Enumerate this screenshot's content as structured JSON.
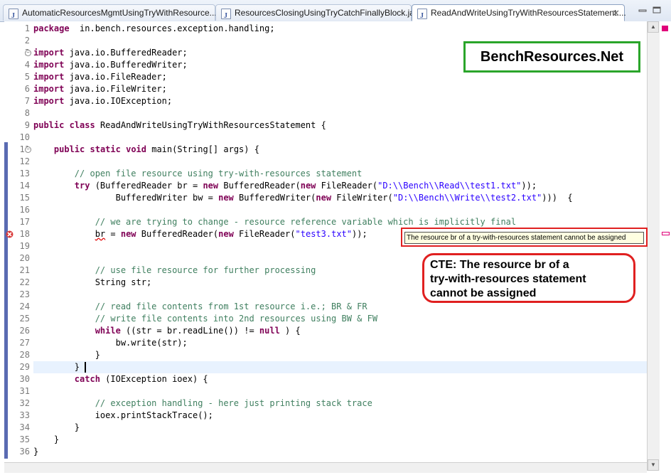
{
  "tabs": [
    {
      "label": "AutomaticResourcesMgmtUsingTryWithResource..."
    },
    {
      "label": "ResourcesClosingUsingTryCatchFinallyBlock.java"
    },
    {
      "label": "ReadAndWriteUsingTryWithResourcesStatement....",
      "close": "✕"
    }
  ],
  "brand": "BenchResources.Net",
  "tooltip": "The resource br of a try-with-resources statement cannot be assigned",
  "callout": [
    "CTE: The resource br of a",
    "try-with-resources statement",
    "cannot be assigned"
  ],
  "colors": {
    "keyword": "#7f0055",
    "comment": "#3f7f5f",
    "string": "#2a00ff",
    "error": "#e02020",
    "brand_border": "#2aa52a"
  },
  "code": [
    {
      "n": "1",
      "tokens": [
        [
          "kw",
          "package"
        ],
        [
          "",
          "  in.bench.resources.exception.handling;"
        ]
      ]
    },
    {
      "n": "2",
      "tokens": []
    },
    {
      "n": "3",
      "fold": "−",
      "tokens": [
        [
          "kw",
          "import"
        ],
        [
          "",
          " java.io.BufferedReader;"
        ]
      ]
    },
    {
      "n": "4",
      "tokens": [
        [
          "kw",
          "import"
        ],
        [
          "",
          " java.io.BufferedWriter;"
        ]
      ]
    },
    {
      "n": "5",
      "tokens": [
        [
          "kw",
          "import"
        ],
        [
          "",
          " java.io.FileReader;"
        ]
      ]
    },
    {
      "n": "6",
      "tokens": [
        [
          "kw",
          "import"
        ],
        [
          "",
          " java.io.FileWriter;"
        ]
      ]
    },
    {
      "n": "7",
      "tokens": [
        [
          "kw",
          "import"
        ],
        [
          "",
          " java.io.IOException;"
        ]
      ]
    },
    {
      "n": "8",
      "tokens": []
    },
    {
      "n": "9",
      "tokens": [
        [
          "kw",
          "public"
        ],
        [
          "",
          " "
        ],
        [
          "kw",
          "class"
        ],
        [
          "",
          " ReadAndWriteUsingTryWithResourcesStatement {"
        ]
      ]
    },
    {
      "n": "10",
      "tokens": []
    },
    {
      "n": "11",
      "fold": "−",
      "tokens": [
        [
          "",
          "    "
        ],
        [
          "kw",
          "public"
        ],
        [
          "",
          " "
        ],
        [
          "kw",
          "static"
        ],
        [
          "",
          " "
        ],
        [
          "kw",
          "void"
        ],
        [
          "",
          " main(String[] args) {"
        ]
      ]
    },
    {
      "n": "12",
      "tokens": []
    },
    {
      "n": "13",
      "tokens": [
        [
          "",
          "        "
        ],
        [
          "cm",
          "// open file resource using try-with-resources statement"
        ]
      ]
    },
    {
      "n": "14",
      "tokens": [
        [
          "",
          "        "
        ],
        [
          "kw",
          "try"
        ],
        [
          "",
          " (BufferedReader br = "
        ],
        [
          "kw",
          "new"
        ],
        [
          "",
          " BufferedReader("
        ],
        [
          "kw",
          "new"
        ],
        [
          "",
          " FileReader("
        ],
        [
          "st",
          "\"D:\\\\Bench\\\\Read\\\\test1.txt\""
        ],
        [
          "",
          "));"
        ]
      ]
    },
    {
      "n": "15",
      "tokens": [
        [
          "",
          "                BufferedWriter bw = "
        ],
        [
          "kw",
          "new"
        ],
        [
          "",
          " BufferedWriter("
        ],
        [
          "kw",
          "new"
        ],
        [
          "",
          " FileWriter("
        ],
        [
          "st",
          "\"D:\\\\Bench\\\\Write\\\\test2.txt\""
        ],
        [
          "",
          ")))  {"
        ]
      ]
    },
    {
      "n": "16",
      "tokens": []
    },
    {
      "n": "17",
      "tokens": [
        [
          "",
          "            "
        ],
        [
          "cm",
          "// we are trying to change - resource reference variable which is implicitly final"
        ]
      ]
    },
    {
      "n": "18",
      "error": true,
      "tokens": [
        [
          "",
          "            "
        ],
        [
          "err",
          "br"
        ],
        [
          "",
          " = "
        ],
        [
          "kw",
          "new"
        ],
        [
          "",
          " BufferedReader("
        ],
        [
          "kw",
          "new"
        ],
        [
          "",
          " FileReader("
        ],
        [
          "st",
          "\"test3.txt\""
        ],
        [
          "",
          "));"
        ]
      ]
    },
    {
      "n": "19",
      "tokens": []
    },
    {
      "n": "20",
      "tokens": []
    },
    {
      "n": "21",
      "tokens": [
        [
          "",
          "            "
        ],
        [
          "cm",
          "// use file resource for further processing"
        ]
      ]
    },
    {
      "n": "22",
      "tokens": [
        [
          "",
          "            String str;"
        ]
      ]
    },
    {
      "n": "23",
      "tokens": []
    },
    {
      "n": "24",
      "tokens": [
        [
          "",
          "            "
        ],
        [
          "cm",
          "// read file contents from 1st resource i.e.; BR & FR"
        ]
      ]
    },
    {
      "n": "25",
      "tokens": [
        [
          "",
          "            "
        ],
        [
          "cm",
          "// write file contents into 2nd resources using BW & FW"
        ]
      ]
    },
    {
      "n": "26",
      "tokens": [
        [
          "",
          "            "
        ],
        [
          "kw",
          "while"
        ],
        [
          "",
          " ((str = br.readLine()) != "
        ],
        [
          "kw",
          "null"
        ],
        [
          "",
          " ) {"
        ]
      ]
    },
    {
      "n": "27",
      "tokens": [
        [
          "",
          "                bw.write(str);"
        ]
      ]
    },
    {
      "n": "28",
      "tokens": [
        [
          "",
          "            }"
        ]
      ]
    },
    {
      "n": "29",
      "current": true,
      "tokens": [
        [
          "",
          "        } "
        ]
      ]
    },
    {
      "n": "30",
      "tokens": [
        [
          "",
          "        "
        ],
        [
          "kw",
          "catch"
        ],
        [
          "",
          " (IOException ioex) {"
        ]
      ]
    },
    {
      "n": "31",
      "tokens": []
    },
    {
      "n": "32",
      "tokens": [
        [
          "",
          "            "
        ],
        [
          "cm",
          "// exception handling - here just printing stack trace"
        ]
      ]
    },
    {
      "n": "33",
      "tokens": [
        [
          "",
          "            ioex.printStackTrace();"
        ]
      ]
    },
    {
      "n": "34",
      "tokens": [
        [
          "",
          "        }"
        ]
      ]
    },
    {
      "n": "35",
      "tokens": [
        [
          "",
          "    }"
        ]
      ]
    },
    {
      "n": "36",
      "tokens": [
        [
          "",
          "}"
        ]
      ]
    }
  ]
}
